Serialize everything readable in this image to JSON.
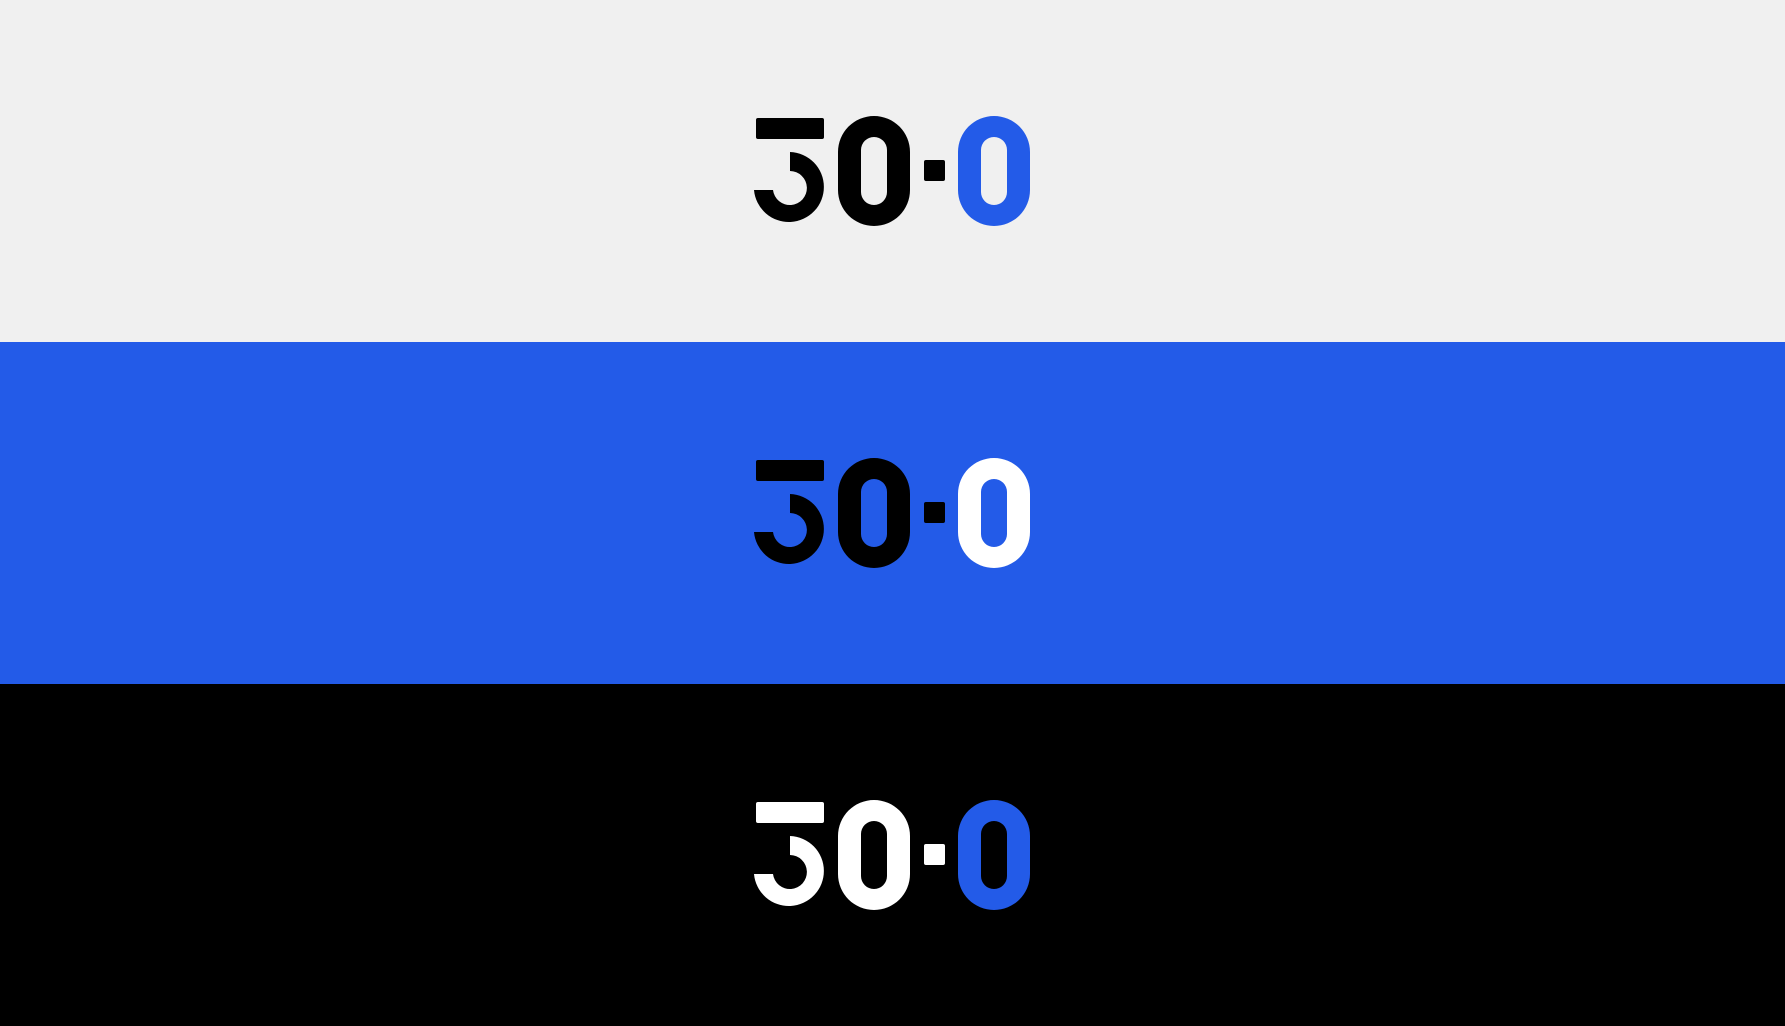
{
  "logo": {
    "text": "30-0"
  },
  "bands": [
    {
      "background": "#f0f0f0",
      "digits_color": "#000000",
      "last_zero_color": "#235be8"
    },
    {
      "background": "#235be8",
      "digits_color": "#000000",
      "last_zero_color": "#ffffff"
    },
    {
      "background": "#000000",
      "digits_color": "#ffffff",
      "last_zero_color": "#235be8"
    }
  ],
  "colors": {
    "light": "#f0f0f0",
    "blue": "#235be8",
    "black": "#000000",
    "white": "#ffffff"
  }
}
